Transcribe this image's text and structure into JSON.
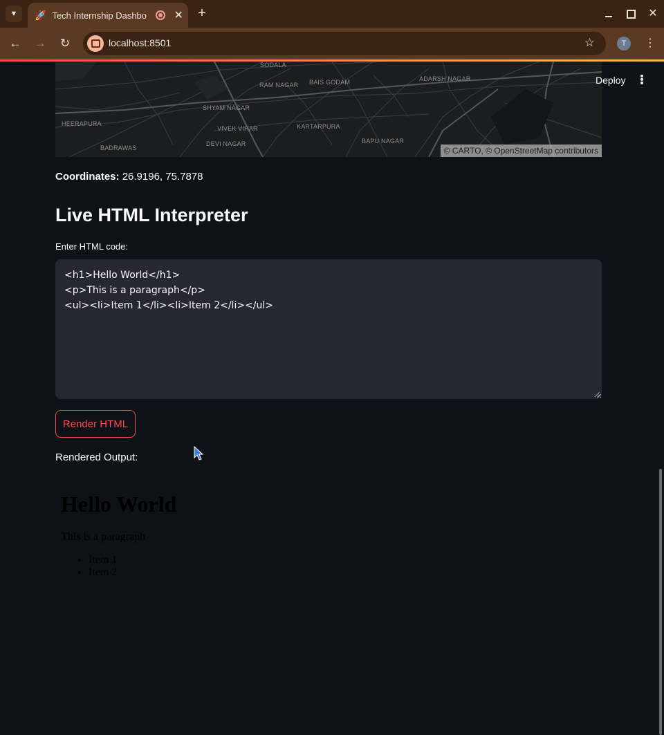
{
  "browser": {
    "tab": {
      "title": "Tech Internship Dashbo",
      "favicon": "🚀"
    },
    "new_tab": "+",
    "url": "localhost:8501",
    "profile_initial": "T"
  },
  "app": {
    "map": {
      "labels": [
        "SODALA",
        "RAM NAGAR",
        "BAIS GODAM",
        "ADARSH NAGAR",
        "SHYAM NAGAR",
        "HEERAPURA",
        "VIVEK VIHAR",
        "KARTARPURA",
        "BADRAWAS",
        "DEVI NAGAR",
        "BAPU NAGAR"
      ],
      "attribution": "© CARTO, © OpenStreetMap contributors"
    },
    "deploy_label": "Deploy",
    "coordinates": {
      "label": "Coordinates:",
      "value": "26.9196, 75.7878"
    },
    "section_title": "Live HTML Interpreter",
    "textarea": {
      "label": "Enter HTML code:",
      "value": "<h1>Hello World</h1>\n<p>This is a paragraph</p>\n<ul><li>Item 1</li><li>Item 2</li></ul>"
    },
    "render_button": "Render HTML",
    "output_label": "Rendered Output:",
    "rendered": {
      "heading": "Hello World",
      "paragraph": "This is a paragraph",
      "items": [
        "Item 1",
        "Item 2"
      ]
    }
  },
  "colors": {
    "background": "#0e1117",
    "accent": "#ff4b4b",
    "textarea_bg": "#262730",
    "browser_frame": "#5a3a22"
  }
}
